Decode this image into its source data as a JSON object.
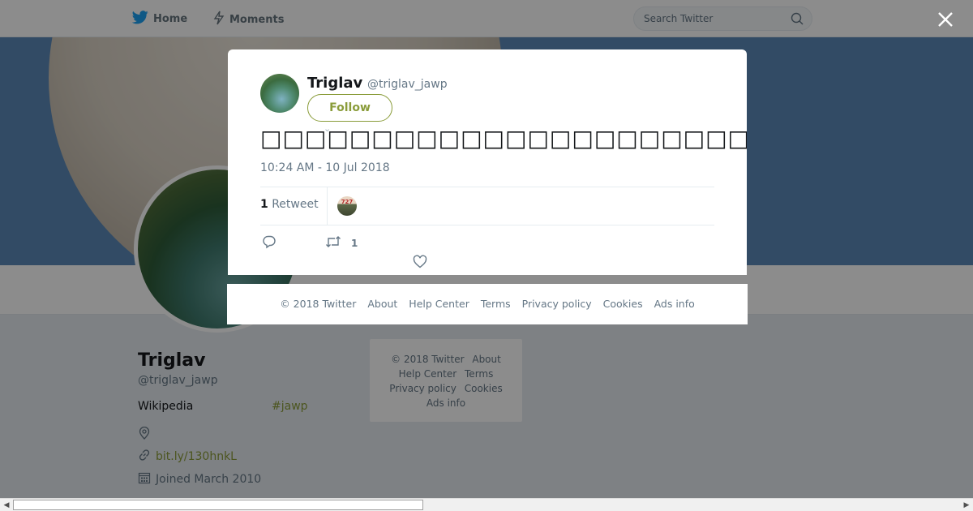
{
  "nav": {
    "home_label": "Home",
    "moments_label": "Moments",
    "search_placeholder": "Search Twitter"
  },
  "profile": {
    "name": "Triglav",
    "handle": "@triglav_jawp",
    "bio": "Wikipedia",
    "hashtag": "#jawp",
    "link": "bit.ly/130hnkL",
    "joined": "Joined March 2010"
  },
  "side_footer": {
    "links": [
      "© 2018 Twitter",
      "About",
      "Help Center",
      "Terms",
      "Privacy policy",
      "Cookies",
      "Ads info"
    ]
  },
  "tweet": {
    "author_name": "Triglav",
    "author_handle": "@triglav_jawp",
    "follow_label": "Follow",
    "text": "□□□□□□□□□□□□□□□□□□□□□□□□□□□□□□□□□□□□□□□□□□□□□□□□□□□",
    "timestamp": "10:24 AM - 10 Jul 2018",
    "retweet_count": "1",
    "retweet_label": "Retweet",
    "retweeter_sign": "727",
    "action_retweet_count": "1"
  },
  "modal_footer": {
    "copyright": "© 2018 Twitter",
    "about": "About",
    "help": "Help Center",
    "terms": "Terms",
    "privacy": "Privacy policy",
    "cookies": "Cookies",
    "ads": "Ads info"
  },
  "colors": {
    "accent": "#8a9c3a",
    "twitter_blue": "#1da1f2",
    "banner": "#5b89b8"
  },
  "icons": [
    "twitter-bird-icon",
    "lightning-icon",
    "search-icon",
    "close-icon",
    "location-icon",
    "link-icon",
    "calendar-icon",
    "reply-icon",
    "retweet-icon",
    "heart-icon",
    "chevron-down-icon"
  ]
}
